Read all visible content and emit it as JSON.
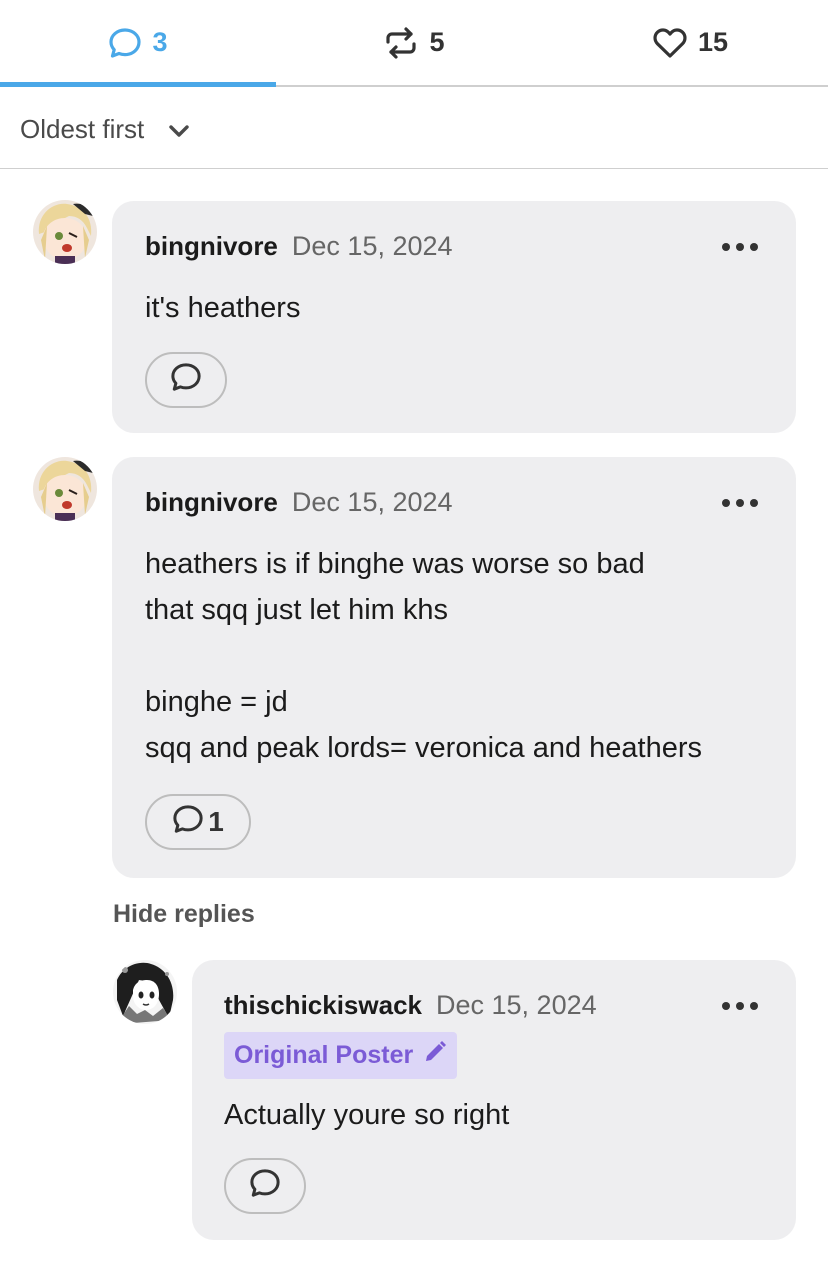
{
  "tabs": {
    "comments": {
      "icon": "comment-icon",
      "count": "3",
      "color": "#4aa8e8"
    },
    "reblogs": {
      "icon": "reblog-icon",
      "count": "5"
    },
    "likes": {
      "icon": "heart-icon",
      "count": "15"
    }
  },
  "sort": {
    "label": "Oldest first",
    "icon": "chevron-down-icon"
  },
  "comments": [
    {
      "username": "bingnivore",
      "date": "Dec 15, 2024",
      "lines": [
        "it's heathers"
      ],
      "reply_count": ""
    },
    {
      "username": "bingnivore",
      "date": "Dec 15, 2024",
      "lines": [
        "heathers is if binghe was worse so bad",
        "that sqq just let him khs",
        "binghe = jd",
        "sqq and peak lords= veronica and heathers"
      ],
      "reply_count": "1"
    }
  ],
  "hide_replies": "Hide replies",
  "reply": {
    "username": "thischickiswack",
    "date": "Dec 15, 2024",
    "badge": "Original Poster",
    "badge_icon": "pencil-icon",
    "badge_color": "#7b5bd6",
    "lines": [
      "Actually youre so right"
    ]
  }
}
